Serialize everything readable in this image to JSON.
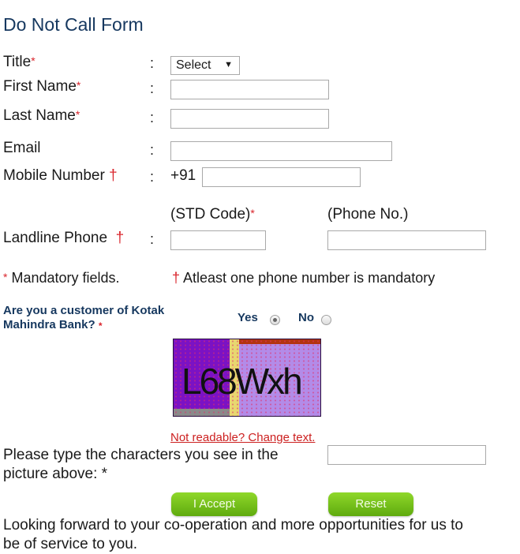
{
  "form": {
    "title": "Do Not Call Form",
    "colon": ":",
    "fields": {
      "title": {
        "label": "Title",
        "required_mark": "*",
        "selected": "Select"
      },
      "first_name": {
        "label": "First Name",
        "required_mark": "*",
        "value": ""
      },
      "last_name": {
        "label": "Last Name",
        "required_mark": "*",
        "value": ""
      },
      "email": {
        "label": "Email",
        "value": ""
      },
      "mobile": {
        "label": "Mobile Number",
        "phone_mark": "†",
        "prefix": "+91",
        "value": ""
      },
      "landline": {
        "label": "Landline Phone",
        "phone_mark": "†",
        "std_label": "(STD Code)",
        "std_required": "*",
        "phone_label": "(Phone No.)",
        "std_value": "",
        "phone_value": ""
      }
    },
    "notes": {
      "mandatory_mark": "*",
      "mandatory_text": "Mandatory fields.",
      "phone_mark": "†",
      "phone_text": "Atleast one phone number is mandatory"
    },
    "customer_question": {
      "line1": "Are you a customer of Kotak",
      "line2": "Mahindra Bank?",
      "required_mark": "*",
      "options": [
        {
          "label": "Yes",
          "selected": true
        },
        {
          "label": "No",
          "selected": false
        }
      ]
    },
    "captcha": {
      "text": "L68Wxh",
      "change_link": "Not readable? Change text.",
      "prompt_line1": "Please type the characters you see in the",
      "prompt_line2": "picture above: *",
      "value": ""
    },
    "buttons": {
      "accept": "I Accept",
      "reset": "Reset"
    },
    "footer_line1": "Looking forward to your co-operation and more opportunities for us to",
    "footer_line2": "be of service to you."
  }
}
